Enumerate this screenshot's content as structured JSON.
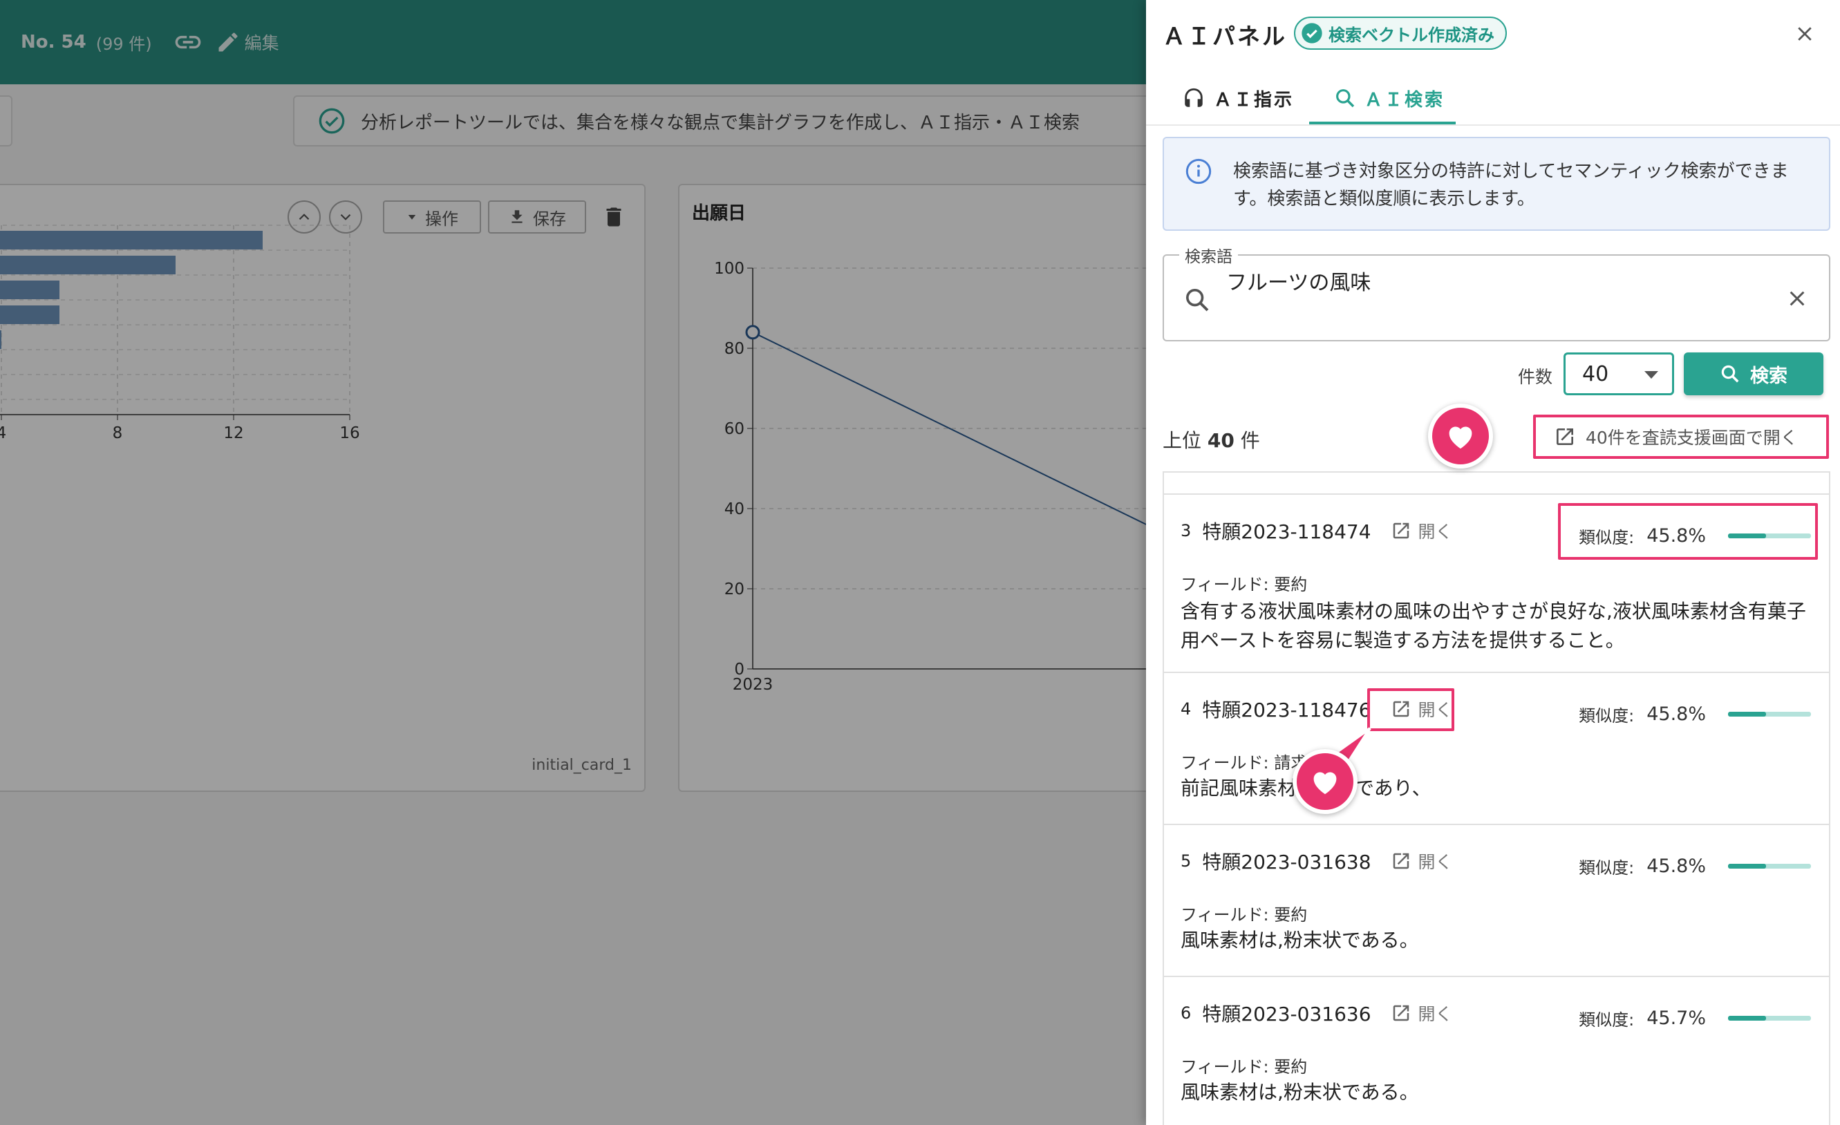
{
  "app": {
    "record_no": "No. 54",
    "record_count": "(99 件)",
    "edit_label": "編集",
    "notice": "分析レポートツールでは、集合を様々な観点で集計グラフを作成し、ＡＩ指示・ＡＩ検索",
    "card1": {
      "operate_label": "操作",
      "save_label": "保存",
      "name": "initial_card_1"
    },
    "card2": {
      "title": "出願日"
    }
  },
  "chart_data": [
    {
      "type": "bar",
      "orientation": "horizontal",
      "values": [
        13,
        10,
        6,
        6,
        4
      ],
      "xlim": [
        4,
        16
      ],
      "x_ticks": [
        "4",
        "8",
        "12",
        "16"
      ],
      "grid": true,
      "color": "#6f95bd"
    },
    {
      "type": "line",
      "title": "出願日",
      "x": [
        "2023"
      ],
      "y": [
        84
      ],
      "ylim": [
        0,
        100
      ],
      "y_ticks": [
        "0",
        "20",
        "40",
        "60",
        "80",
        "100"
      ],
      "x_ticks": [
        "2023"
      ],
      "grid": true,
      "color": "#2a5a8f"
    }
  ],
  "panel": {
    "title": "ＡＩパネル",
    "vector_badge": "検索ベクトル作成済み",
    "tabs": [
      {
        "label": "ＡＩ指示",
        "active": false
      },
      {
        "label": "ＡＩ検索",
        "active": true
      }
    ],
    "info_text": "検索語に基づき対象区分の特許に対してセマンティック検索ができます。検索語と類似度順に表示します。",
    "search": {
      "legend": "検索語",
      "value": "フルーツの風味"
    },
    "count_label": "件数",
    "count_value": "40",
    "search_button": "検索",
    "top_prefix": "上位",
    "top_count": "40",
    "top_suffix": "件",
    "open_all_label": "40件を査読支援画面で開く",
    "results": [
      {
        "rank": "3",
        "id": "特願2023-118474",
        "open": "開く",
        "sim_label": "類似度:",
        "sim": "45.8%",
        "sim_value": 45.8,
        "field": "フィールド: 要約",
        "text": "含有する液状風味素材の風味の出やすさが良好な,液状風味素材含有菓子用ペーストを容易に製造する方法を提供すること。"
      },
      {
        "rank": "4",
        "id": "特願2023-118476",
        "open": "開く",
        "sim_label": "類似度:",
        "sim": "45.8%",
        "sim_value": 45.8,
        "field": "フィールド: 請求",
        "text": "前記風味素材が液状であり、"
      },
      {
        "rank": "5",
        "id": "特願2023-031638",
        "open": "開く",
        "sim_label": "類似度:",
        "sim": "45.8%",
        "sim_value": 45.8,
        "field": "フィールド: 要約",
        "text": "風味素材は,粉末状である。"
      },
      {
        "rank": "6",
        "id": "特願2023-031636",
        "open": "開く",
        "sim_label": "類似度:",
        "sim": "45.7%",
        "sim_value": 45.7,
        "field": "フィールド: 要約",
        "text": "風味素材は,粉末状である。"
      }
    ]
  },
  "colors": {
    "accent": "#2aa391",
    "highlight": "#e8336d",
    "topbar": "#2a8f82"
  }
}
